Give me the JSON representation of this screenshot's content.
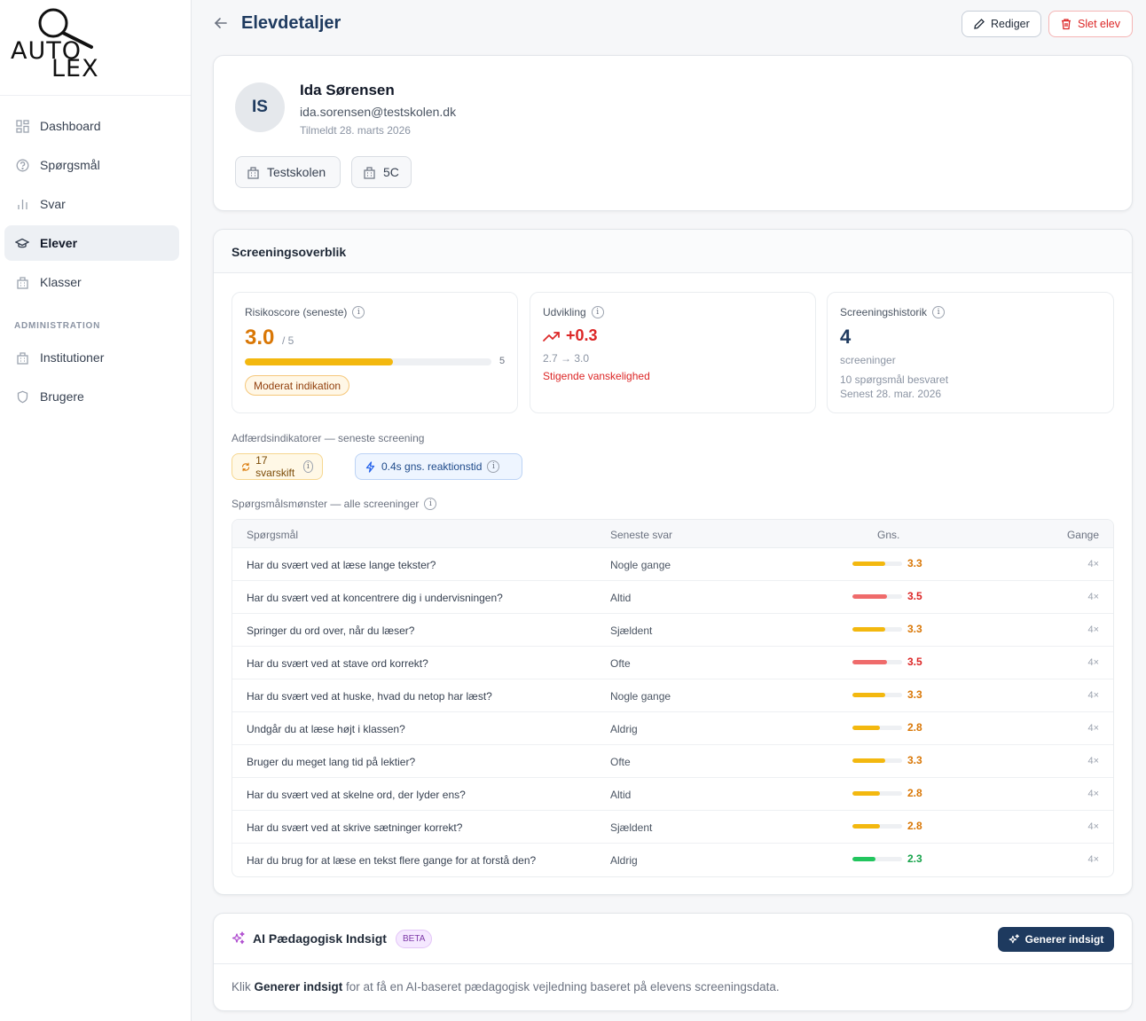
{
  "logo": {
    "line1": "AUTO",
    "line2": "LEX"
  },
  "sidebar": {
    "items": [
      {
        "label": "Dashboard",
        "icon": "grid-icon"
      },
      {
        "label": "Spørgsmål",
        "icon": "question-circle-icon"
      },
      {
        "label": "Svar",
        "icon": "bar-chart-icon"
      },
      {
        "label": "Elever",
        "icon": "graduation-cap-icon",
        "active": true
      },
      {
        "label": "Klasser",
        "icon": "building-icon"
      }
    ],
    "admin_label": "ADMINISTRATION",
    "admin_items": [
      {
        "label": "Institutioner",
        "icon": "building-icon"
      },
      {
        "label": "Brugere",
        "icon": "shield-icon"
      }
    ]
  },
  "header": {
    "title": "Elevdetaljer",
    "edit_label": "Rediger",
    "delete_label": "Slet elev"
  },
  "student": {
    "initials": "IS",
    "name": "Ida Sørensen",
    "email": "ida.sorensen@testskolen.dk",
    "joined": "Tilmeldt 28. marts 2026",
    "school": "Testskolen",
    "class": "5C"
  },
  "screening": {
    "title": "Screeningsoverblik",
    "risk": {
      "label": "Risikoscore (seneste)",
      "value": "3.0",
      "max_text": "/ 5",
      "scale_end": "5",
      "fraction": 0.6,
      "badge": "Moderat indikation"
    },
    "development": {
      "label": "Udvikling",
      "value": "+0.3",
      "range": "2.7 → 3.0",
      "note": "Stigende vanskelighed"
    },
    "history": {
      "label": "Screeningshistorik",
      "value": "4",
      "unit": "screeninger",
      "questions": "10 spørgsmål besvaret",
      "last": "Senest 28. mar. 2026"
    },
    "behavior_label": "Adfærdsindikatorer — seneste screening",
    "behavior": {
      "switches": "17 svarskift",
      "reaction": "0.4s gns. reaktionstid"
    },
    "pattern_label": "Spørgsmålsmønster — alle screeninger",
    "columns": {
      "question": "Spørgsmål",
      "latest": "Seneste svar",
      "avg": "Gns.",
      "count": "Gange"
    },
    "rows": [
      {
        "question": "Har du svært ved at læse lange tekster?",
        "latest": "Nogle gange",
        "avg": "3.3",
        "avg_value": 3.3,
        "level": "mid",
        "count": "4×"
      },
      {
        "question": "Har du svært ved at koncentrere dig i undervisningen?",
        "latest": "Altid",
        "avg": "3.5",
        "avg_value": 3.5,
        "level": "high",
        "count": "4×"
      },
      {
        "question": "Springer du ord over, når du læser?",
        "latest": "Sjældent",
        "avg": "3.3",
        "avg_value": 3.3,
        "level": "mid",
        "count": "4×"
      },
      {
        "question": "Har du svært ved at stave ord korrekt?",
        "latest": "Ofte",
        "avg": "3.5",
        "avg_value": 3.5,
        "level": "high",
        "count": "4×"
      },
      {
        "question": "Har du svært ved at huske, hvad du netop har læst?",
        "latest": "Nogle gange",
        "avg": "3.3",
        "avg_value": 3.3,
        "level": "mid",
        "count": "4×"
      },
      {
        "question": "Undgår du at læse højt i klassen?",
        "latest": "Aldrig",
        "avg": "2.8",
        "avg_value": 2.8,
        "level": "mid",
        "count": "4×"
      },
      {
        "question": "Bruger du meget lang tid på lektier?",
        "latest": "Ofte",
        "avg": "3.3",
        "avg_value": 3.3,
        "level": "mid",
        "count": "4×"
      },
      {
        "question": "Har du svært ved at skelne ord, der lyder ens?",
        "latest": "Altid",
        "avg": "2.8",
        "avg_value": 2.8,
        "level": "mid",
        "count": "4×"
      },
      {
        "question": "Har du svært ved at skrive sætninger korrekt?",
        "latest": "Sjældent",
        "avg": "2.8",
        "avg_value": 2.8,
        "level": "mid",
        "count": "4×"
      },
      {
        "question": "Har du brug for at læse en tekst flere gange for at forstå den?",
        "latest": "Aldrig",
        "avg": "2.3",
        "avg_value": 2.3,
        "level": "low",
        "count": "4×"
      }
    ]
  },
  "ai": {
    "title": "AI Pædagogisk Indsigt",
    "badge": "BETA",
    "button": "Generer indsigt",
    "text_prefix": "Klik ",
    "text_link": "Generer indsigt",
    "text_suffix": " for at få en AI-baseret pædagogisk vejledning baseret på elevens screeningsdata."
  },
  "colors": {
    "high": "#dc2626",
    "mid": "#d97706",
    "low": "#16a34a",
    "bar_high": "#ef6b6b",
    "bar_mid": "#f3b80f",
    "bar_low": "#22c55e"
  }
}
